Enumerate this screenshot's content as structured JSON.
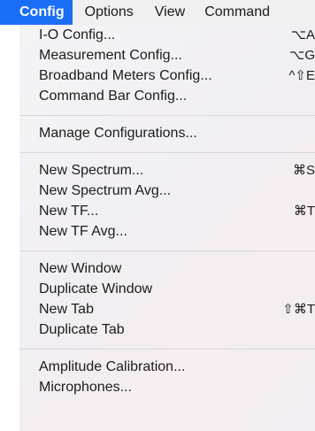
{
  "menubar": {
    "items": [
      {
        "label": "Config",
        "active": true
      },
      {
        "label": "Options"
      },
      {
        "label": "View"
      },
      {
        "label": "Command"
      }
    ]
  },
  "menu": {
    "groups": [
      {
        "items": [
          {
            "label": "I-O Config...",
            "shortcut": "⌥A"
          },
          {
            "label": "Measurement Config...",
            "shortcut": "⌥G"
          },
          {
            "label": "Broadband Meters Config...",
            "shortcut": "^⇧E"
          },
          {
            "label": "Command Bar Config...",
            "shortcut": ""
          }
        ]
      },
      {
        "items": [
          {
            "label": "Manage Configurations...",
            "shortcut": ""
          }
        ]
      },
      {
        "items": [
          {
            "label": "New Spectrum...",
            "shortcut": "⌘S"
          },
          {
            "label": "New Spectrum Avg...",
            "shortcut": ""
          },
          {
            "label": "New TF...",
            "shortcut": "⌘T"
          },
          {
            "label": "New TF Avg...",
            "shortcut": ""
          }
        ]
      },
      {
        "items": [
          {
            "label": "New Window",
            "shortcut": ""
          },
          {
            "label": "Duplicate Window",
            "shortcut": ""
          },
          {
            "label": "New Tab",
            "shortcut": "⇧⌘T"
          },
          {
            "label": "Duplicate Tab",
            "shortcut": ""
          }
        ]
      },
      {
        "items": [
          {
            "label": "Amplitude Calibration...",
            "shortcut": ""
          },
          {
            "label": "Microphones...",
            "shortcut": ""
          }
        ]
      }
    ]
  },
  "colors": {
    "accent": "#1a6ef5",
    "menubar_bg": "#f0f0f0",
    "text": "#1c1c1c",
    "separator": "#d7d5d9"
  }
}
